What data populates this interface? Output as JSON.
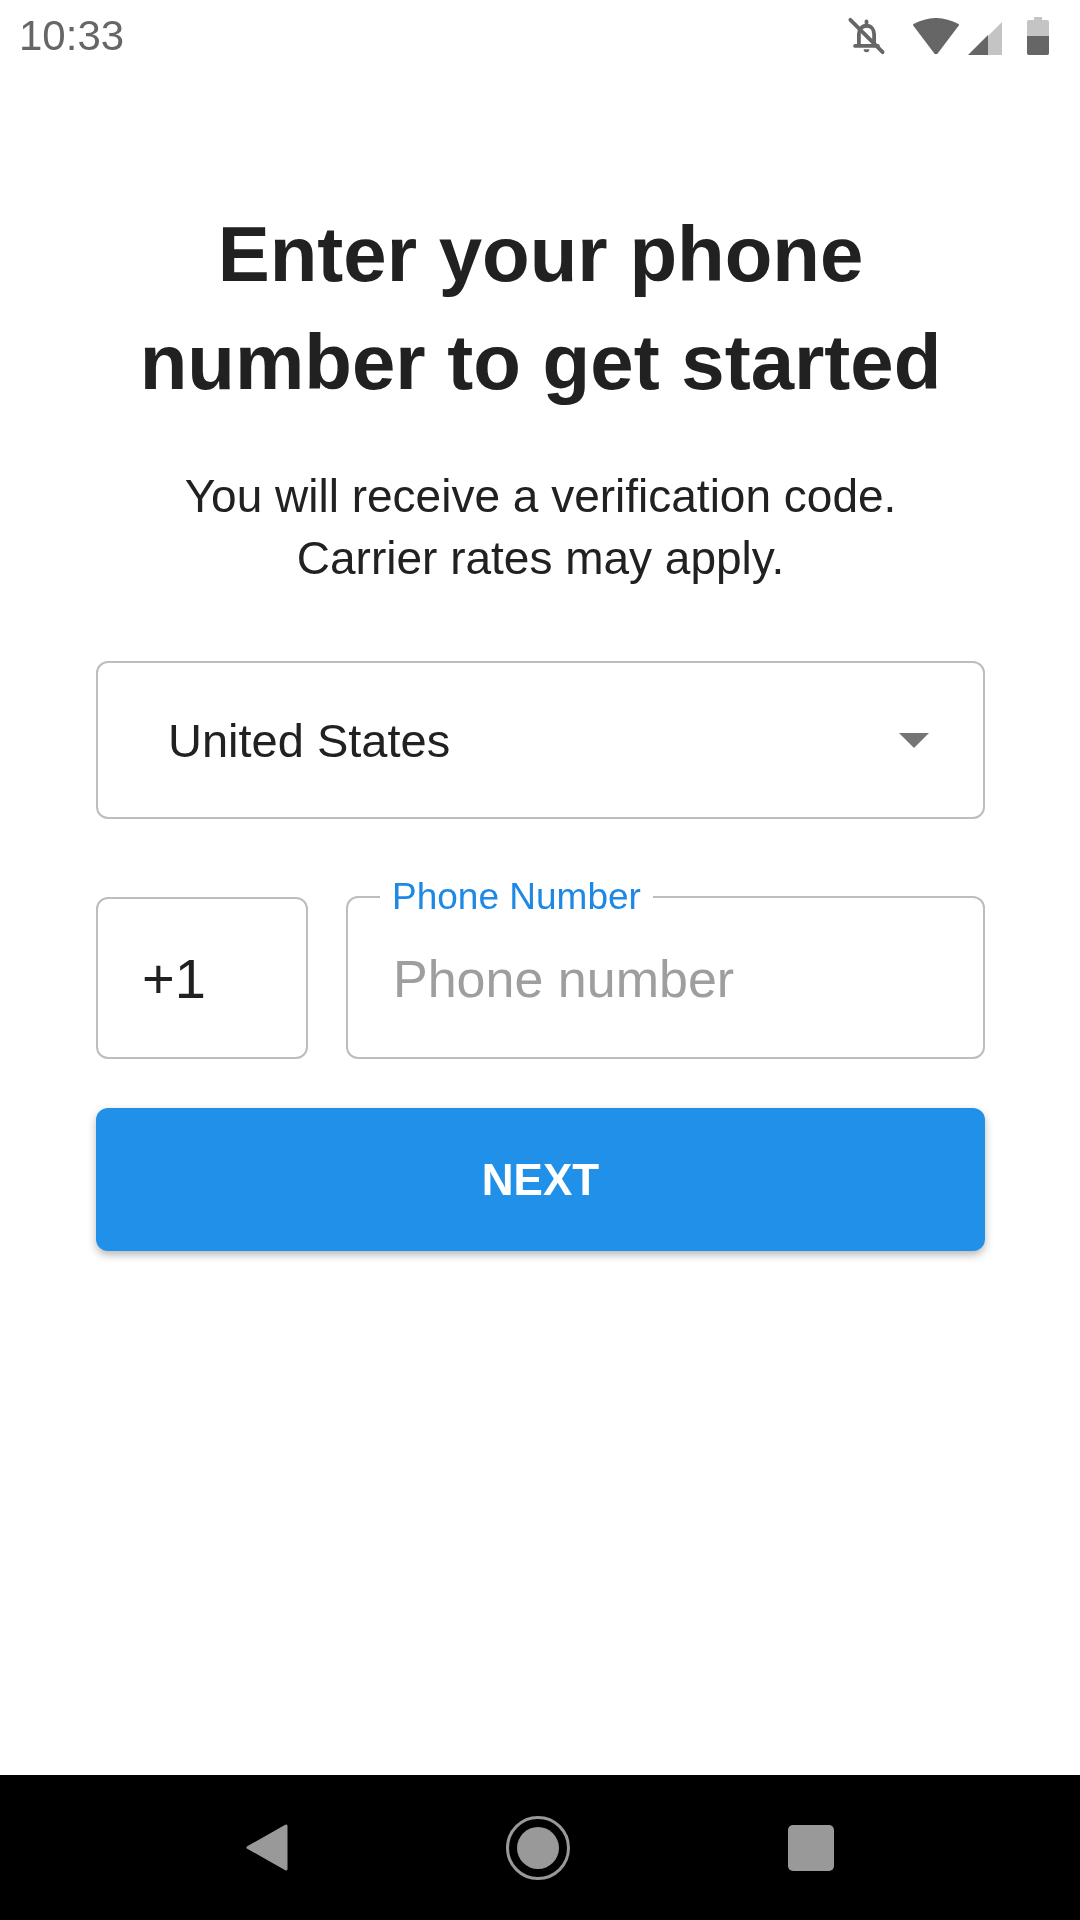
{
  "status_bar": {
    "time": "10:33"
  },
  "heading": {
    "title": "Enter your phone number to get started",
    "subtitle": "You will receive a verification code. Carrier rates may apply."
  },
  "country_select": {
    "value": "United States"
  },
  "phone_row": {
    "country_code": "+1",
    "phone_field": {
      "label": "Phone Number",
      "placeholder": "Phone number"
    }
  },
  "next_button": {
    "label": "NEXT"
  }
}
